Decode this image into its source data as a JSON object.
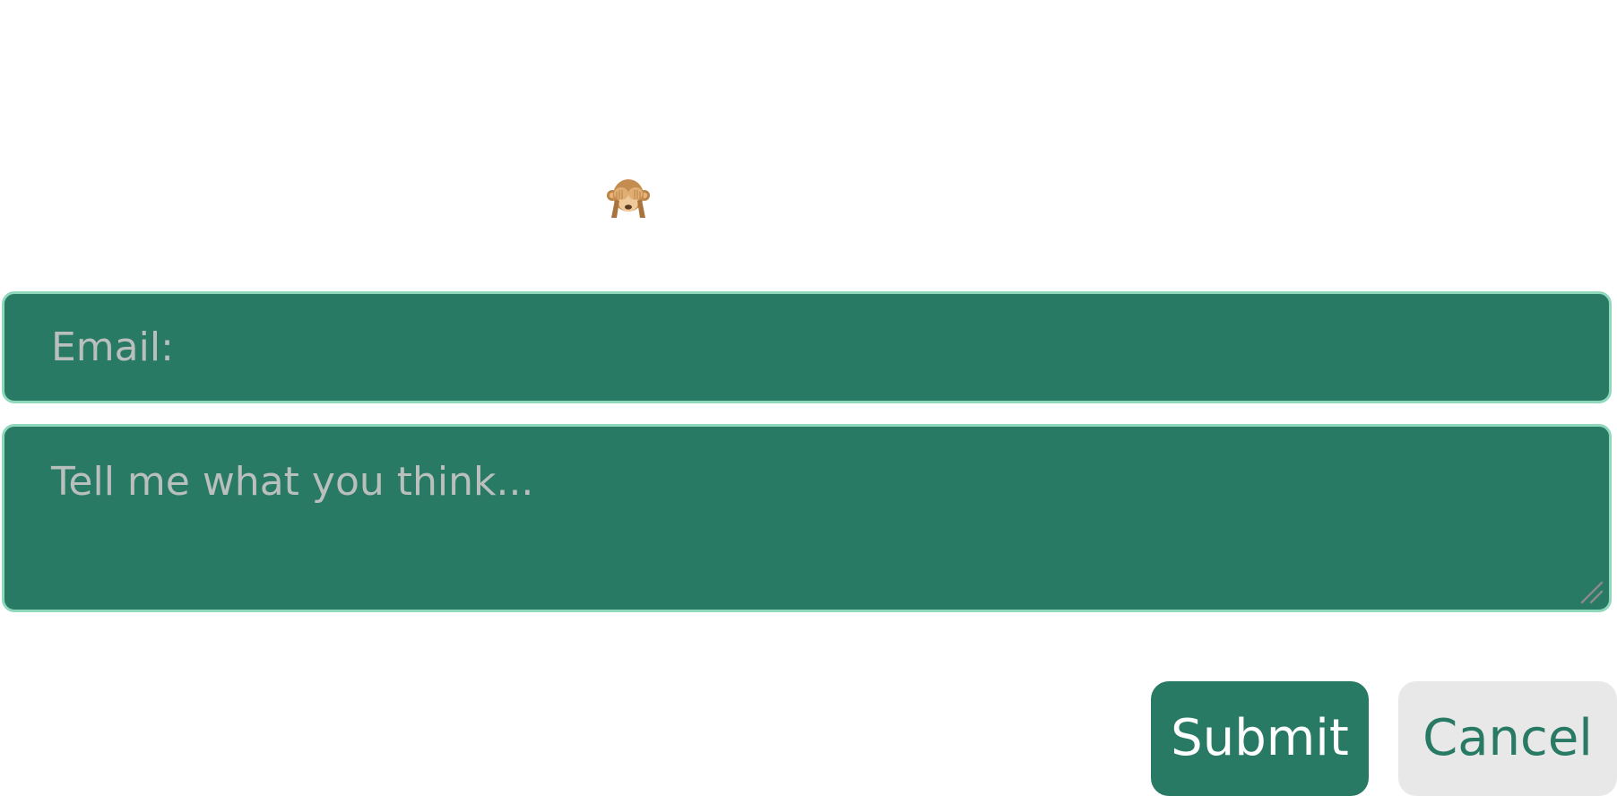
{
  "header": {
    "icon": "see-no-evil-monkey-icon"
  },
  "form": {
    "email_placeholder": "Email:",
    "feedback_placeholder": "Tell me what you think..."
  },
  "buttons": {
    "submit_label": "Submit",
    "cancel_label": "Cancel"
  },
  "colors": {
    "primary": "#287a64",
    "field_border": "#8fd8bc",
    "placeholder_text": "#b9bfbc",
    "cancel_bg": "#e8e8e8"
  }
}
